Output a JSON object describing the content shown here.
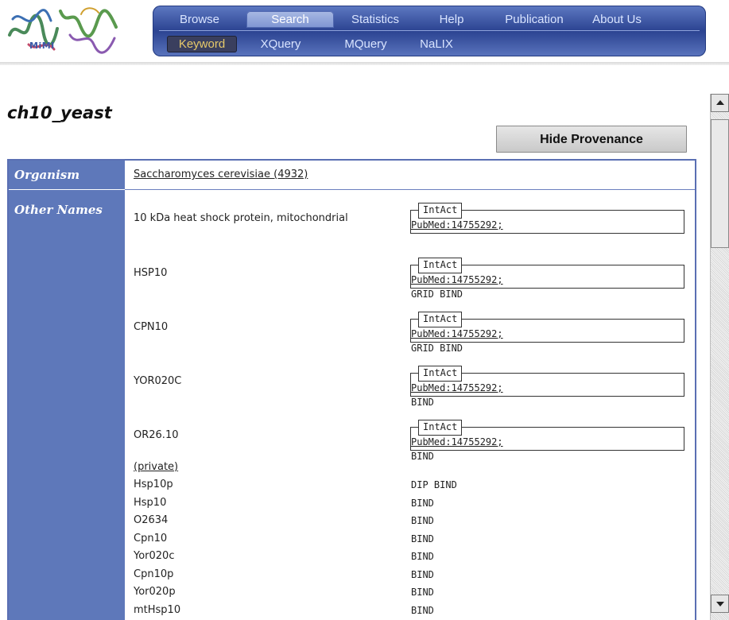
{
  "logo": {
    "text": "MiMI"
  },
  "nav": {
    "top": [
      {
        "label": "Browse",
        "active": false
      },
      {
        "label": "Search",
        "active": true
      },
      {
        "label": "Statistics",
        "active": false
      },
      {
        "label": "Help",
        "active": false
      },
      {
        "label": "Publication",
        "active": false
      },
      {
        "label": "About Us",
        "active": false
      }
    ],
    "sub": [
      {
        "label": "Keyword",
        "active": true
      },
      {
        "label": "XQuery",
        "active": false
      },
      {
        "label": "MQuery",
        "active": false
      },
      {
        "label": "NaLIX",
        "active": false
      }
    ]
  },
  "page": {
    "title": "ch10_yeast",
    "hide_button": "Hide Provenance"
  },
  "fields": {
    "organism_label": "Organism",
    "organism_value": "Saccharomyces cerevisiae (4932)",
    "other_names_label": "Other Names"
  },
  "provenance": {
    "tab": "IntAct",
    "pubmed": "PubMed:14755292;"
  },
  "names": [
    {
      "name": "10 kDa heat shock protein, mitochondrial",
      "tail": ""
    },
    {
      "name": "HSP10",
      "tail": "GRID BIND"
    },
    {
      "name": "CPN10",
      "tail": "GRID BIND"
    },
    {
      "name": "YOR020C",
      "tail": "BIND"
    },
    {
      "name": "OR26.10",
      "tail": "BIND"
    }
  ],
  "private_label": "(private)",
  "private_names": [
    {
      "name": "Hsp10p",
      "source": "DIP BIND"
    },
    {
      "name": "Hsp10",
      "source": "BIND"
    },
    {
      "name": "O2634",
      "source": "BIND"
    },
    {
      "name": "Cpn10",
      "source": "BIND"
    },
    {
      "name": "Yor020c",
      "source": "BIND"
    },
    {
      "name": "Cpn10p",
      "source": "BIND"
    },
    {
      "name": "Yor020p",
      "source": "BIND"
    },
    {
      "name": "mtHsp10",
      "source": "BIND"
    }
  ],
  "colors": {
    "nav_dark": "#2d4593",
    "label_column": "#5e78ba",
    "active_sub_text": "#e6c96a"
  }
}
